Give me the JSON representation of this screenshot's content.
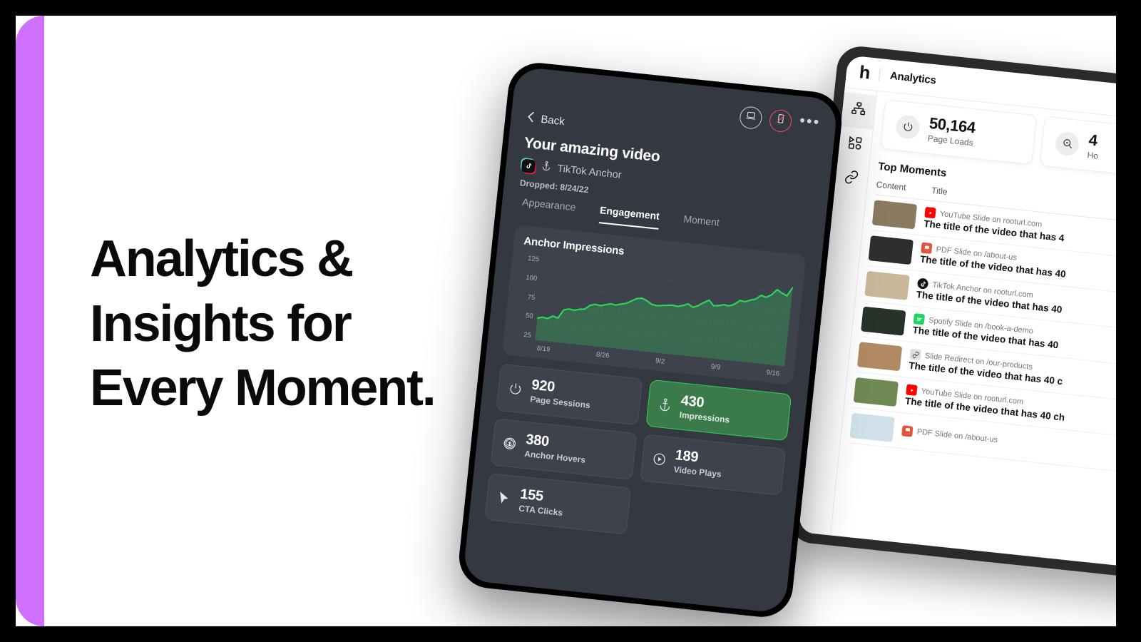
{
  "theme": {
    "accent_purple": "#ce70fb",
    "accent_green": "#2fd35a",
    "highlight_card_bg": "#3b7a4b",
    "phone_bg": "#343841",
    "card_bg": "#3d424c",
    "danger_red": "#e0555a"
  },
  "headline": {
    "line1": "Analytics &",
    "line2": "Insights for",
    "line3": "Every Moment."
  },
  "phone": {
    "toolbar": {
      "desktop_icon": "desktop-icon",
      "mobile_disabled_icon": "mobile-disabled-icon",
      "more_icon": "more-dots-icon",
      "more_label": "•••"
    },
    "back_label": "Back",
    "video_title": "Your amazing video",
    "source_icon": "tiktok-icon",
    "anchor_icon": "anchor-icon",
    "source_name": "TikTok Anchor",
    "dropped_label": "Dropped: 8/24/22",
    "tabs": [
      {
        "label": "Appearance",
        "active": false
      },
      {
        "label": "Engagement",
        "active": true
      },
      {
        "label": "Moment",
        "active": false
      }
    ],
    "stats": [
      {
        "value": "920",
        "label": "Page Sessions",
        "icon": "power-icon",
        "highlight": false
      },
      {
        "value": "430",
        "label": "Impressions",
        "icon": "anchor-icon",
        "highlight": true
      },
      {
        "value": "380",
        "label": "Anchor Hovers",
        "icon": "anchor-hover-icon",
        "highlight": false
      },
      {
        "value": "189",
        "label": "Video Plays",
        "icon": "play-circle-icon",
        "highlight": false
      },
      {
        "value": "155",
        "label": "CTA Clicks",
        "icon": "cursor-icon",
        "highlight": false
      }
    ]
  },
  "chart_data": {
    "type": "area",
    "title": "Anchor Impressions",
    "xlabel": "",
    "ylabel": "",
    "ylim": [
      25,
      140
    ],
    "yticks": [
      125,
      100,
      75,
      50,
      25
    ],
    "xticks": [
      "8/19",
      "8/26",
      "9/2",
      "9/9",
      "9/16"
    ],
    "grid": true,
    "line_color": "#2fd35a",
    "fill_color": "rgba(47,211,90,0.28)",
    "x": [
      0,
      1,
      2,
      3,
      4,
      5,
      6,
      7,
      8,
      9,
      10,
      11,
      12,
      13,
      14,
      15,
      16,
      17,
      18,
      19,
      20,
      21,
      22,
      23,
      24,
      25,
      26,
      27,
      28,
      29,
      30,
      31,
      32,
      33,
      34,
      35,
      36,
      37,
      38,
      39,
      40,
      41,
      42,
      43,
      44,
      45,
      46,
      47,
      48,
      49
    ],
    "values": [
      55,
      57,
      56,
      60,
      58,
      70,
      72,
      71,
      73,
      74,
      80,
      82,
      81,
      83,
      85,
      84,
      86,
      88,
      92,
      96,
      97,
      94,
      90,
      89,
      90,
      91,
      92,
      91,
      93,
      96,
      92,
      95,
      100,
      104,
      97,
      98,
      100,
      99,
      102,
      108,
      107,
      110,
      112,
      118,
      116,
      120,
      128,
      124,
      121,
      133
    ]
  },
  "tablet": {
    "logo": "h",
    "title": "Analytics",
    "sidebar": [
      {
        "icon": "sitemap-icon",
        "active": true
      },
      {
        "icon": "content-grid-icon",
        "active": false
      },
      {
        "icon": "link-icon",
        "active": false
      }
    ],
    "kpis": [
      {
        "value": "50,164",
        "label": "Page Loads",
        "icon": "power-icon"
      },
      {
        "value": "4",
        "label": "Ho",
        "icon": "hover-search-icon"
      }
    ],
    "moments_title": "Top Moments",
    "columns": [
      "Content",
      "Title"
    ],
    "rows": [
      {
        "badge": "youtube-icon",
        "source": "YouTube Slide on rooturl.com",
        "title": "The title of the video that has 4",
        "thumb": "#8a7a60"
      },
      {
        "badge": "pdf-icon",
        "source": "PDF Slide on /about-us",
        "title": "The title of the video that has 40",
        "thumb": "#2e2e2e"
      },
      {
        "badge": "tiktok-icon",
        "source": "TikTok Anchor on rooturl.com",
        "title": "The title of the video that has 40",
        "thumb": "#c9b79a"
      },
      {
        "badge": "spotify-icon",
        "source": "Spotify Slide on /book-a-demo",
        "title": "The title of the video that has 40 ",
        "thumb": "#26322a"
      },
      {
        "badge": "link-icon",
        "source": "Slide Redirect on /our-products",
        "title": "The title of the video that has 40 c",
        "thumb": "#b08a63"
      },
      {
        "badge": "youtube-icon",
        "source": "YouTube Slide on rooturl.com",
        "title": "The title of the video that has 40 ch",
        "thumb": "#6e8a52"
      },
      {
        "badge": "pdf-icon",
        "source": "PDF Slide on /about-us",
        "title": "",
        "thumb": "#cfe0ea"
      }
    ]
  }
}
